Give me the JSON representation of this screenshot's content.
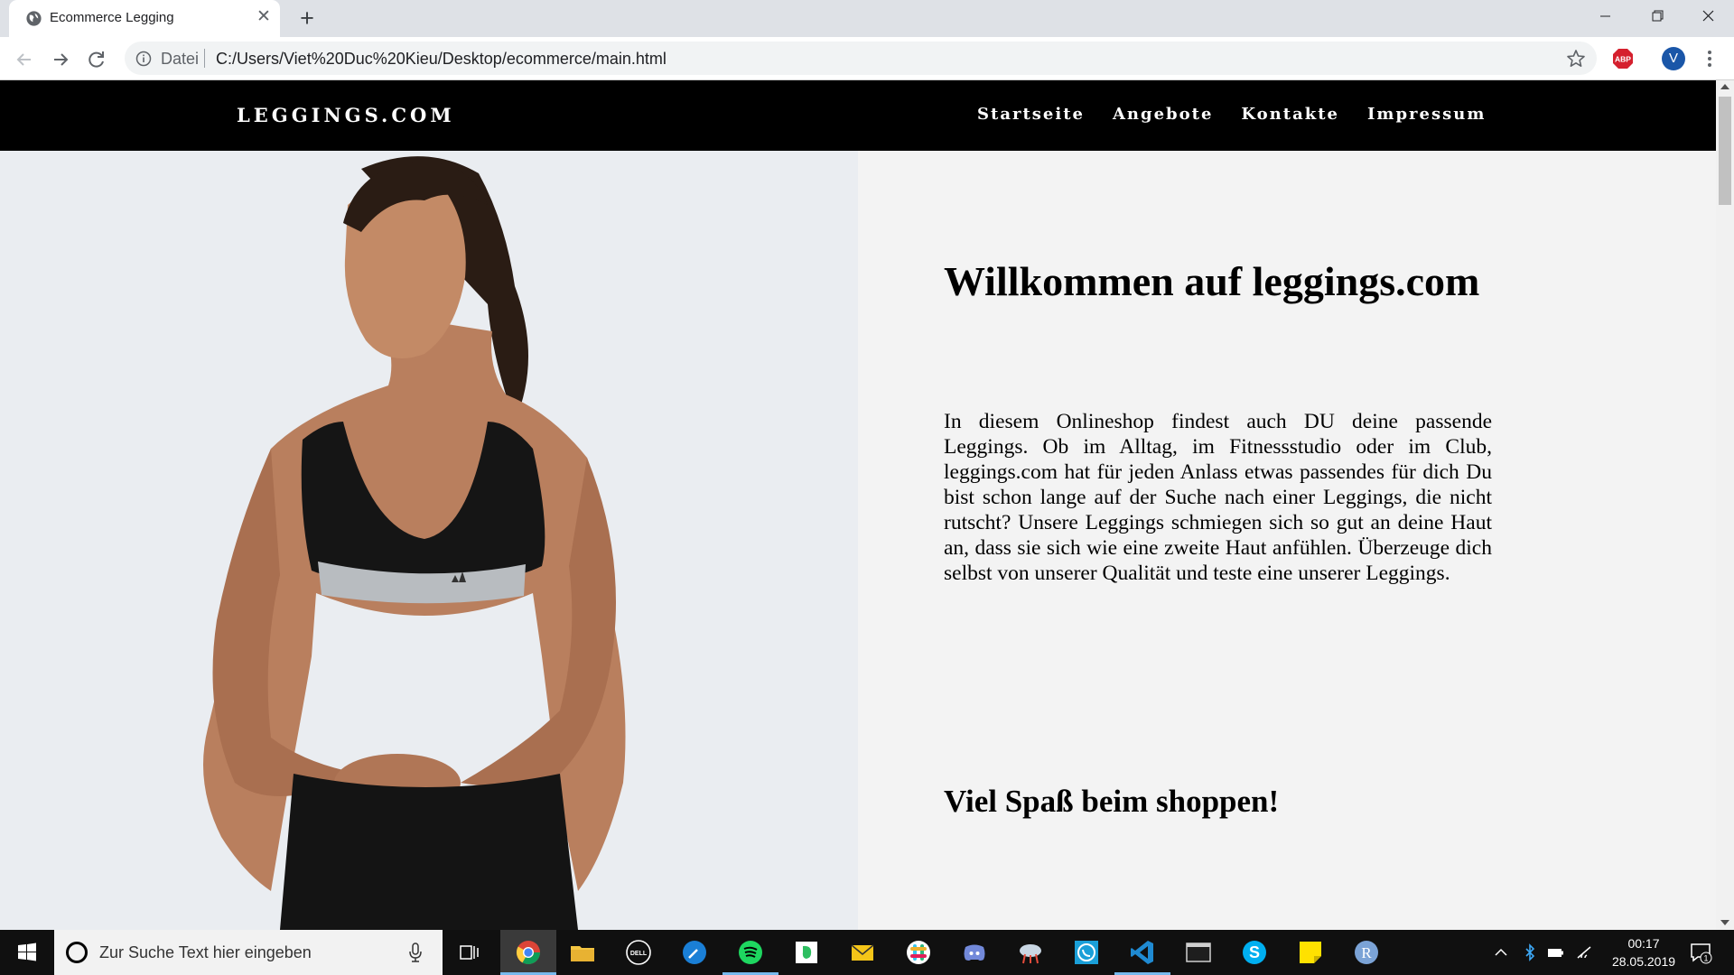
{
  "browser": {
    "tab_title": "Ecommerce Legging",
    "omnibox": {
      "scheme_label": "Datei",
      "url": "C:/Users/Viet%20Duc%20Kieu/Desktop/ecommerce/main.html"
    },
    "profile_initial": "V",
    "extension_label": "ABP"
  },
  "site": {
    "brand": "LEGGINGS.COM",
    "nav": [
      "Startseite",
      "Angebote",
      "Kontakte",
      "Impressum"
    ],
    "welcome_heading": "Willkommen auf leggings.com",
    "intro_text": "In diesem Onlineshop findest auch DU deine passende Leggings. Ob im Alltag, im Fitnessstudio oder im Club, leggings.com hat für jeden Anlass etwas passendes für dich Du bist schon lange auf der Suche nach einer Leggings, die nicht rutscht? Unsere Leggings schmiegen sich so gut an deine Haut an, dass sie sich wie eine zweite Haut anfühlen. Überzeuge dich selbst von unserer Qualität und teste eine unserer Leggings.",
    "closing_heading": "Viel Spaß beim shoppen!",
    "colors": {
      "nav_bg": "#000000",
      "page_bg": "#f3f3f3",
      "hero_bg": "#eaedf1"
    }
  },
  "taskbar": {
    "search_placeholder": "Zur Suche Text hier eingeben",
    "clock_time": "00:17",
    "clock_date": "28.05.2019",
    "notification_count": "1",
    "pinned_apps": [
      "task-view",
      "chrome",
      "file-explorer",
      "dell",
      "app-blue",
      "spotify",
      "evernote",
      "mail",
      "slack",
      "discord",
      "app-cloud",
      "whatsapp",
      "vscode",
      "terminal",
      "skype",
      "sticky-notes",
      "r-app"
    ]
  }
}
